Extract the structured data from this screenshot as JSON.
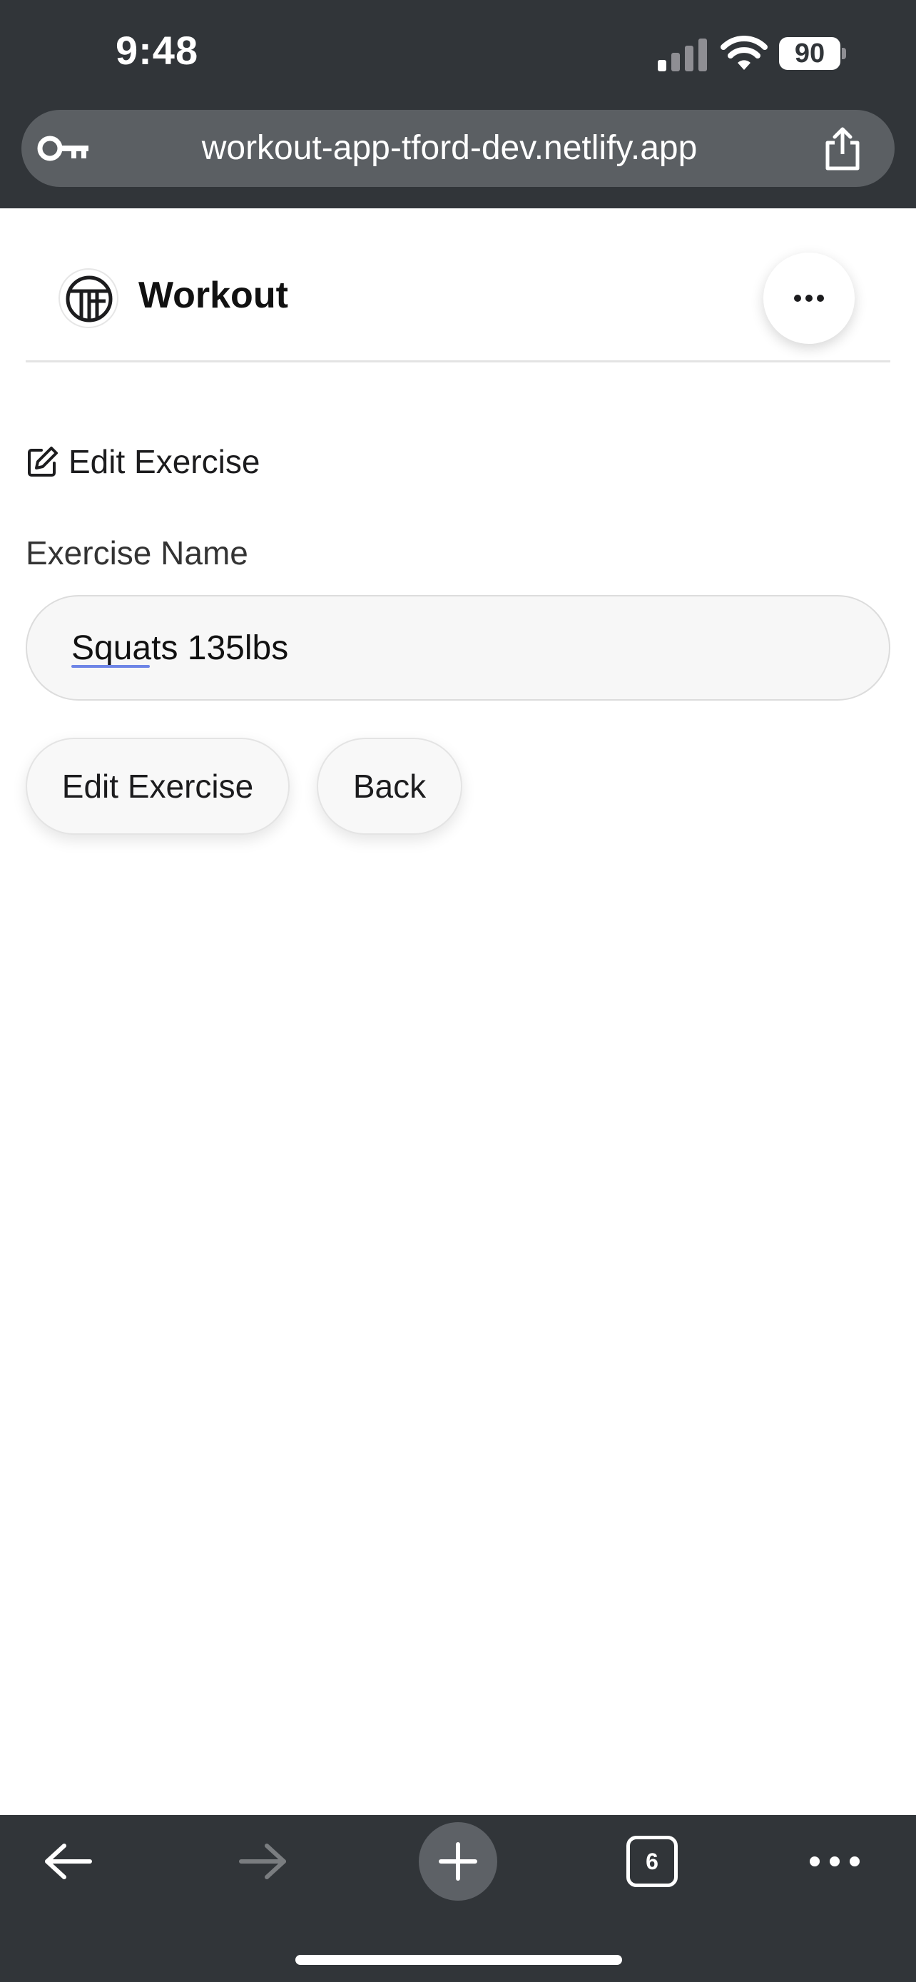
{
  "status_bar": {
    "time": "9:48",
    "battery_level": "90",
    "signal_icon": "cellular-signal-icon",
    "wifi_icon": "wifi-icon"
  },
  "browser": {
    "url": "workout-app-tford-dev.netlify.app",
    "leading_icon": "key-icon",
    "trailing_icon": "share-icon",
    "tab_count": "6",
    "toolbar_icons": [
      "back-arrow-icon",
      "forward-arrow-icon",
      "plus-icon",
      "tabs-icon",
      "more-icon"
    ]
  },
  "header": {
    "title": "Workout",
    "menu_icon": "ellipsis-icon"
  },
  "form": {
    "heading": "Edit Exercise",
    "heading_icon": "edit-icon",
    "field_label": "Exercise Name",
    "exercise_name": "Squats 135lbs",
    "submit_label": "Edit Exercise",
    "back_label": "Back"
  },
  "colors": {
    "chrome_background": "#313539",
    "url_bar_background": "#5b5f63",
    "page_background": "#ffffff",
    "input_background": "#f7f7f7"
  }
}
